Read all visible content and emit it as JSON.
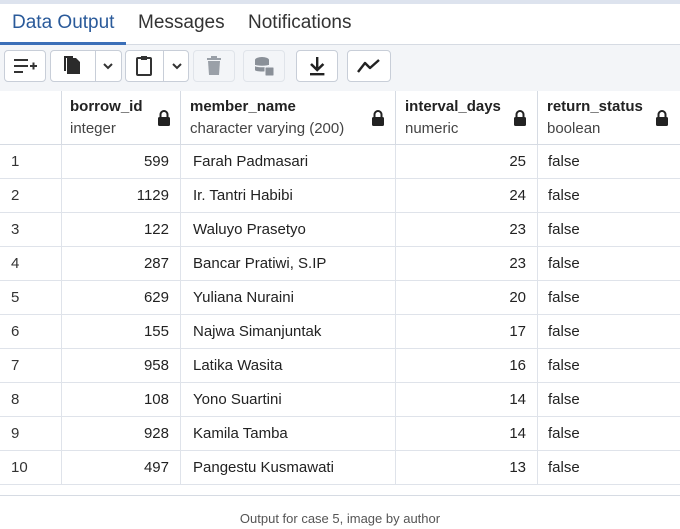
{
  "tabs": [
    {
      "label": "Data Output",
      "active": true
    },
    {
      "label": "Messages",
      "active": false
    },
    {
      "label": "Notifications",
      "active": false
    }
  ],
  "toolbar": {
    "buttons": [
      {
        "icon": "add-row-icon"
      },
      {
        "icon": "copy-icon"
      },
      {
        "icon": "paste-icon"
      },
      {
        "icon": "delete-icon"
      },
      {
        "icon": "save-data-icon"
      },
      {
        "icon": "download-icon"
      },
      {
        "icon": "graph-icon"
      }
    ]
  },
  "columns": [
    {
      "name": "borrow_id",
      "type": "integer"
    },
    {
      "name": "member_name",
      "type": "character varying (200)"
    },
    {
      "name": "interval_days",
      "type": "numeric"
    },
    {
      "name": "return_status",
      "type": "boolean"
    }
  ],
  "rows": [
    {
      "num": "1",
      "borrow_id": "599",
      "member_name": "Farah Padmasari",
      "interval_days": "25",
      "return_status": "false"
    },
    {
      "num": "2",
      "borrow_id": "1129",
      "member_name": "Ir. Tantri Habibi",
      "interval_days": "24",
      "return_status": "false"
    },
    {
      "num": "3",
      "borrow_id": "122",
      "member_name": "Waluyo Prasetyo",
      "interval_days": "23",
      "return_status": "false"
    },
    {
      "num": "4",
      "borrow_id": "287",
      "member_name": "Bancar Pratiwi, S.IP",
      "interval_days": "23",
      "return_status": "false"
    },
    {
      "num": "5",
      "borrow_id": "629",
      "member_name": "Yuliana Nuraini",
      "interval_days": "20",
      "return_status": "false"
    },
    {
      "num": "6",
      "borrow_id": "155",
      "member_name": "Najwa Simanjuntak",
      "interval_days": "17",
      "return_status": "false"
    },
    {
      "num": "7",
      "borrow_id": "958",
      "member_name": "Latika Wasita",
      "interval_days": "16",
      "return_status": "false"
    },
    {
      "num": "8",
      "borrow_id": "108",
      "member_name": "Yono Suartini",
      "interval_days": "14",
      "return_status": "false"
    },
    {
      "num": "9",
      "borrow_id": "928",
      "member_name": "Kamila Tamba",
      "interval_days": "14",
      "return_status": "false"
    },
    {
      "num": "10",
      "borrow_id": "497",
      "member_name": "Pangestu Kusmawati",
      "interval_days": "13",
      "return_status": "false"
    }
  ],
  "caption": "Output for case 5, image by author",
  "colors": {
    "accent": "#3b6fb8",
    "grid_line": "#dfe3ea",
    "toolbar_bg": "#f3f5f8"
  }
}
